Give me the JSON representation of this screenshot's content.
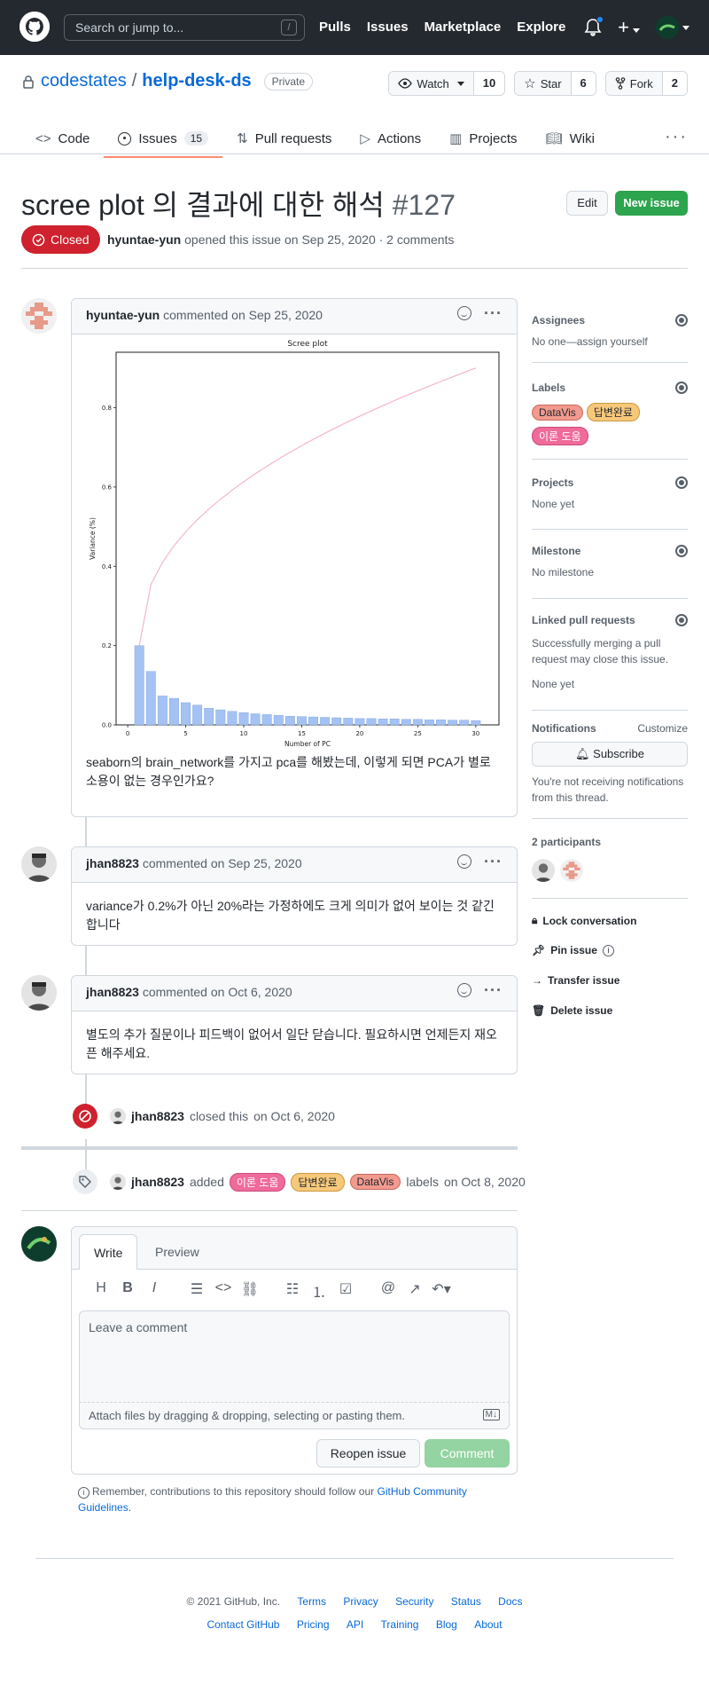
{
  "header": {
    "search_placeholder": "Search or jump to...",
    "slash": "/",
    "nav": [
      "Pulls",
      "Issues",
      "Marketplace",
      "Explore"
    ]
  },
  "repo": {
    "owner": "codestates",
    "sep": "/",
    "name": "help-desk-ds",
    "visibility": "Private",
    "watch": {
      "label": "Watch",
      "count": "10"
    },
    "star": {
      "label": "Star",
      "count": "6"
    },
    "fork": {
      "label": "Fork",
      "count": "2"
    }
  },
  "tabs": [
    {
      "label": "Code"
    },
    {
      "label": "Issues",
      "count": "15"
    },
    {
      "label": "Pull requests"
    },
    {
      "label": "Actions"
    },
    {
      "label": "Projects"
    },
    {
      "label": "Wiki"
    }
  ],
  "issue": {
    "title": "scree plot 의 결과에 대한 해석",
    "number": "#127",
    "edit": "Edit",
    "new_issue": "New issue",
    "state": "Closed",
    "author": "hyuntae-yun",
    "meta_rest": "opened this issue on Sep 25, 2020 · 2 comments"
  },
  "comments": [
    {
      "author": "hyuntae-yun",
      "action": "commented on Sep 25, 2020",
      "body": "seaborn의 brain_network를 가지고 pca를 해봤는데, 이렇게 되면 PCA가 별로 소용이 없는 경우인가요?"
    },
    {
      "author": "jhan8823",
      "action": "commented on Sep 25, 2020",
      "body": "variance가 0.2%가 아닌 20%라는 가정하에도 크게 의미가 없어 보이는 것 같긴 합니다"
    },
    {
      "author": "jhan8823",
      "action": "commented on Oct 6, 2020",
      "body": "별도의 추가 질문이나 피드백이 없어서 일단 닫습니다. 필요하시면 언제든지 재오픈 해주세요."
    }
  ],
  "chart_data": {
    "type": "bar",
    "title": "Scree plot",
    "xlabel": "Number of PC",
    "ylabel": "Variance (%)",
    "x": [
      1,
      2,
      3,
      4,
      5,
      6,
      7,
      8,
      9,
      10,
      11,
      12,
      13,
      14,
      15,
      16,
      17,
      18,
      19,
      20,
      21,
      22,
      23,
      24,
      25,
      26,
      27,
      28,
      29,
      30
    ],
    "values": [
      0.2,
      0.135,
      0.073,
      0.067,
      0.056,
      0.05,
      0.042,
      0.038,
      0.034,
      0.031,
      0.028,
      0.026,
      0.024,
      0.022,
      0.021,
      0.02,
      0.019,
      0.018,
      0.017,
      0.016,
      0.016,
      0.015,
      0.015,
      0.014,
      0.014,
      0.013,
      0.013,
      0.012,
      0.012,
      0.011
    ],
    "cumulative": [
      0.2,
      0.335,
      0.408,
      0.475,
      0.531,
      0.581,
      0.623,
      0.661,
      0.695,
      0.726,
      0.754,
      0.78,
      0.804,
      0.826,
      0.847,
      0.867,
      0.886,
      0.904,
      0.921,
      0.937,
      0.953,
      0.968,
      0.983,
      0.997,
      1.011,
      1.024,
      1.037,
      1.049,
      1.061,
      1.072
    ],
    "xticks": [
      0,
      5,
      10,
      15,
      20,
      25,
      30
    ],
    "yticks": [
      "0.0",
      "0.2",
      "0.4",
      "0.6",
      "0.8"
    ],
    "xlim": [
      -1,
      32
    ],
    "ylim": [
      0,
      0.94
    ],
    "bar_color": "#a4c2f4",
    "line_color": "#f4b6c8"
  },
  "events": [
    {
      "actor": "jhan8823",
      "text": "closed this",
      "date": "on Oct 6, 2020"
    },
    {
      "actor": "jhan8823",
      "text": "added",
      "labels": [
        "이론 도움",
        "답변완료",
        "DataVis"
      ],
      "after": "labels",
      "date": "on Oct 8, 2020"
    }
  ],
  "sidebar": {
    "assignees": {
      "title": "Assignees",
      "value": "No one—assign yourself"
    },
    "labels": {
      "title": "Labels",
      "items": [
        "DataVis",
        "답변완료",
        "이론 도움"
      ]
    },
    "projects": {
      "title": "Projects",
      "value": "None yet"
    },
    "milestone": {
      "title": "Milestone",
      "value": "No milestone"
    },
    "linked": {
      "title": "Linked pull requests",
      "desc": "Successfully merging a pull request may close this issue.",
      "value": "None yet"
    },
    "notifications": {
      "title": "Notifications",
      "customize": "Customize",
      "subscribe": "Subscribe",
      "desc": "You're not receiving notifications from this thread."
    },
    "participants": "2 participants",
    "actions": [
      "Lock conversation",
      "Pin issue",
      "Transfer issue",
      "Delete issue"
    ]
  },
  "editor": {
    "write": "Write",
    "preview": "Preview",
    "placeholder": "Leave a comment",
    "attach": "Attach files by dragging & dropping, selecting or pasting them.",
    "reopen": "Reopen issue",
    "comment": "Comment",
    "note": "Remember, contributions to this repository should follow our",
    "note_link": "GitHub Community Guidelines."
  },
  "footer": {
    "copy": "© 2021 GitHub, Inc.",
    "row1": [
      "Terms",
      "Privacy",
      "Security",
      "Status",
      "Docs"
    ],
    "row2": [
      "Contact GitHub",
      "Pricing",
      "API",
      "Training",
      "Blog",
      "About"
    ]
  },
  "colors": {
    "datavis": "#f29a8e",
    "done": "#f7c87a",
    "theory": "#f06a9a",
    "closed": "#cf222e",
    "green": "#2da44e"
  }
}
